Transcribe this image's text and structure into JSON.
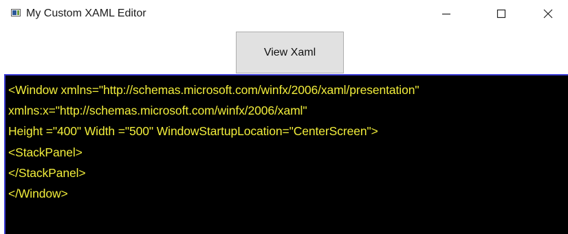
{
  "window": {
    "title": "My Custom XAML Editor",
    "icon": "app-window-icon",
    "controls": {
      "minimize_icon": "minimize-icon",
      "maximize_icon": "maximize-icon",
      "close_icon": "close-icon"
    }
  },
  "toolbar": {
    "view_button_label": "View Xaml"
  },
  "editor": {
    "background_color": "#000000",
    "text_color": "#f2ee3b",
    "border_color": "#3c3cd6",
    "lines": [
      "<Window xmlns=\"http://schemas.microsoft.com/winfx/2006/xaml/presentation\"",
      "xmlns:x=\"http://schemas.microsoft.com/winfx/2006/xaml\"",
      "Height =\"400\" Width =\"500\" WindowStartupLocation=\"CenterScreen\">",
      "<StackPanel>",
      "</StackPanel>",
      "</Window>"
    ]
  }
}
